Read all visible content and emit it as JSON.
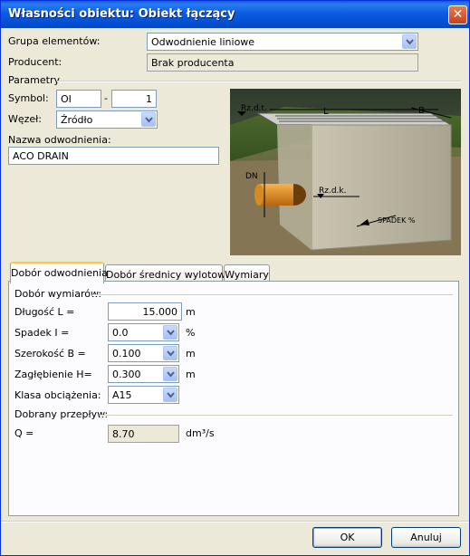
{
  "window": {
    "title": "Własności obiektu: Obiekt łączący"
  },
  "fields": {
    "grupa_label": "Grupa elementów:",
    "grupa_value": "Odwodnienie liniowe",
    "producent_label": "Producent:",
    "producent_value": "Brak producenta"
  },
  "parametry": {
    "group_label": "Parametry",
    "symbol_label": "Symbol:",
    "symbol_prefix": "OI",
    "symbol_sep": "-",
    "symbol_number": "1",
    "wezel_label": "Węzeł:",
    "wezel_value": "Źródło",
    "nazwa_label": "Nazwa odwodnienia:",
    "nazwa_value": "ACO DRAIN"
  },
  "diagram": {
    "label_rzdt": "Rz.d.t.",
    "label_L": "L",
    "label_B": "B",
    "label_DN": "DN",
    "label_rzdk": "Rz.d.k.",
    "label_spadek": "SPADEK %"
  },
  "tabs": [
    {
      "label": "Dobór odwodnienia",
      "active": true
    },
    {
      "label": "Dobór średnicy wylotowej",
      "active": false
    },
    {
      "label": "Wymiary",
      "active": false
    }
  ],
  "dobor": {
    "group_label": "Dobór wymiarów:",
    "dlugosc_label": "Długość L =",
    "dlugosc_value": "15.000",
    "dlugosc_unit": "m",
    "spadek_label": "Spadek I =",
    "spadek_value": "0.0",
    "spadek_unit": "%",
    "szerokosc_label": "Szerokość B =",
    "szerokosc_value": "0.100",
    "szerokosc_unit": "m",
    "zaglebienie_label": "Zagłębienie H=",
    "zaglebienie_value": "0.300",
    "zaglebienie_unit": "m",
    "klasa_label": "Klasa obciążenia:",
    "klasa_value": "A15",
    "przeplyw_label": "Dobrany przepływ:",
    "q_label": "Q =",
    "q_value": "8.70",
    "q_unit": "dm³/s"
  },
  "buttons": {
    "ok": "OK",
    "cancel": "Anuluj"
  },
  "colors": {
    "titlebar": "#0a5bd8",
    "dialog_bg": "#ece9d8",
    "border_blue": "#7f9db9"
  }
}
